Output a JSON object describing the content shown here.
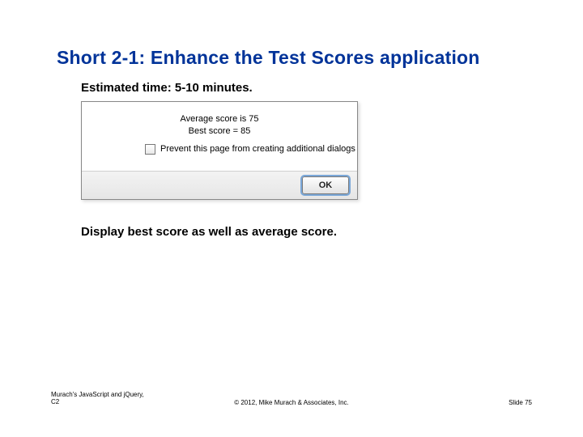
{
  "title": "Short 2-1: Enhance the Test Scores application",
  "estimated_time": "Estimated time: 5-10 minutes.",
  "dialog": {
    "line1": "Average score is 75",
    "line2": "Best score = 85",
    "prevent_label": "Prevent this page from creating additional dialogs",
    "ok_label": "OK"
  },
  "subtext": "Display best score as well as average score.",
  "footer": {
    "left_line1": "Murach's JavaScript and jQuery,",
    "left_line2": "C2",
    "center": "© 2012, Mike Murach & Associates, Inc.",
    "right": "Slide 75"
  }
}
